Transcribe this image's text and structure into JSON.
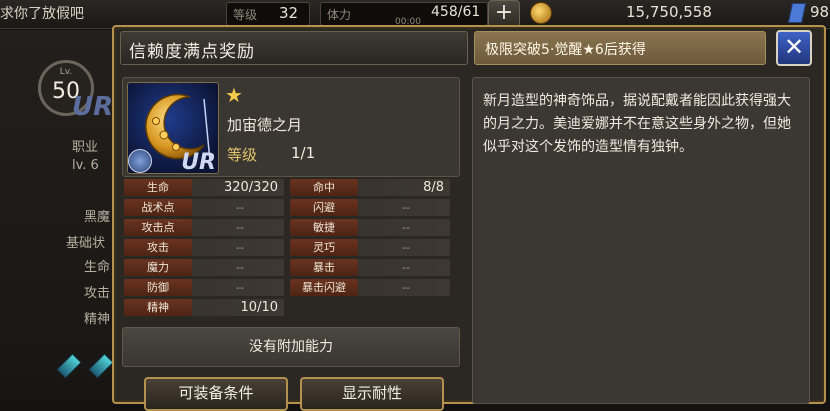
{
  "hud": {
    "player_name": "求你了放假吧",
    "level_label": "等级",
    "level_value": "32",
    "stamina_label": "体力",
    "stamina_value": "458/61",
    "stamina_timer": "00:00",
    "gold": "15,750,558",
    "gems": "98"
  },
  "background": {
    "lv_small": "Lv.",
    "lv_value": "50",
    "ur": "UR",
    "job_label": "职业",
    "job_level": "lv. 6",
    "black_magic": "黑魔",
    "base_label": "基础状",
    "hp_partial": "生命",
    "atk_partial": "攻击",
    "spirit_partial": "精神"
  },
  "dialog": {
    "title": "信赖度满点奖励",
    "condition": "极限突破5·觉醒★6后获得",
    "close": "✕",
    "item": {
      "name": "加宙德之月",
      "level_label": "等级",
      "level_value": "1/1",
      "rarity": "UR"
    },
    "stats_left": [
      {
        "label": "生命",
        "value": "320/320"
      },
      {
        "label": "战术点",
        "value": "--"
      },
      {
        "label": "攻击点",
        "value": "--"
      },
      {
        "label": "攻击",
        "value": "--"
      },
      {
        "label": "魔力",
        "value": "--"
      },
      {
        "label": "防御",
        "value": "--"
      },
      {
        "label": "精神",
        "value": "10/10"
      }
    ],
    "stats_right": [
      {
        "label": "命中",
        "value": "8/8"
      },
      {
        "label": "闪避",
        "value": "--"
      },
      {
        "label": "敏捷",
        "value": "--"
      },
      {
        "label": "灵巧",
        "value": "--"
      },
      {
        "label": "暴击",
        "value": "--"
      },
      {
        "label": "暴击闪避",
        "value": "--"
      }
    ],
    "no_ability": "没有附加能力",
    "equip_conditions_button": "可装备条件",
    "show_resist_button": "显示耐性",
    "description": "新月造型的神奇饰品，据说配戴者能因此获得强大的月之力。美迪爱娜并不在意这些身外之物，但她似乎对这个发饰的造型情有独钟。"
  }
}
